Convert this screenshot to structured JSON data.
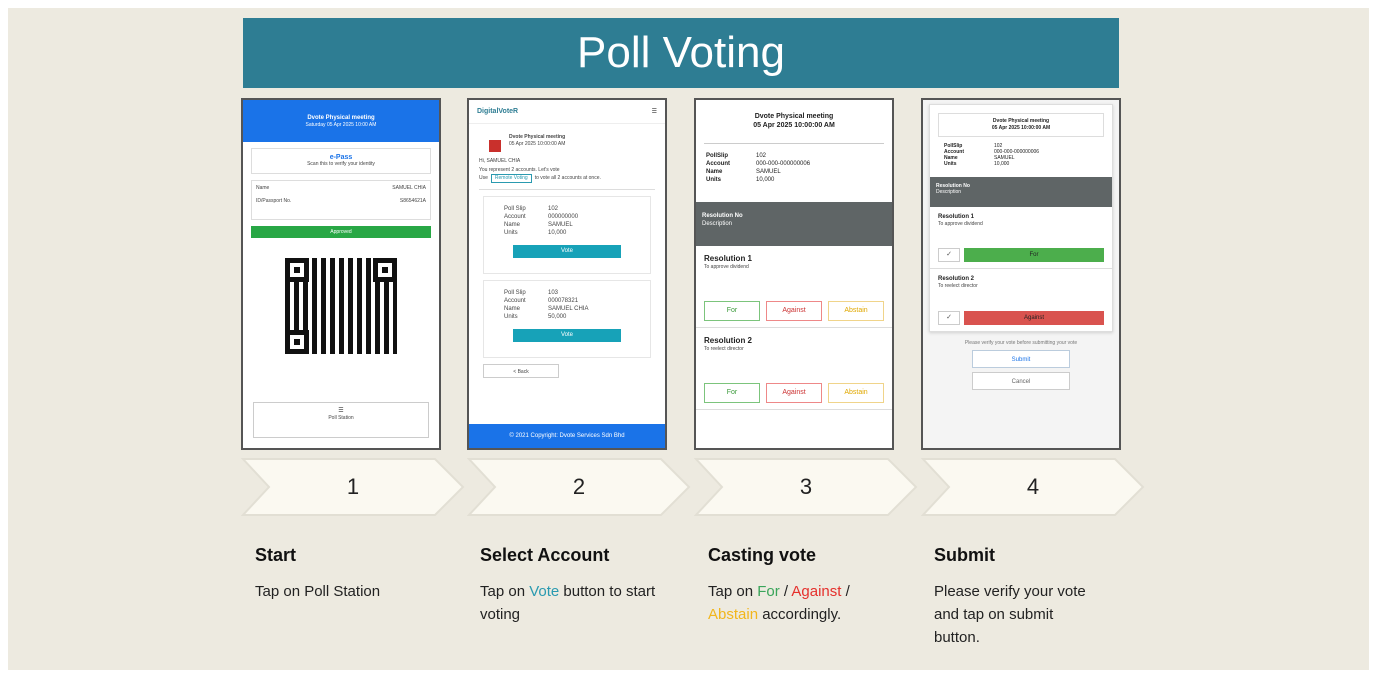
{
  "title": "Poll Voting",
  "steps": [
    {
      "number": "1",
      "heading": "Start",
      "text": "Tap on Poll Station"
    },
    {
      "number": "2",
      "heading": "Select Account",
      "text_pre": "Tap on ",
      "text_vote": "Vote",
      "text_post": " button to start voting"
    },
    {
      "number": "3",
      "heading": "Casting vote",
      "text_pre": "Tap on ",
      "text_for": "For",
      "sep1": " / ",
      "text_against": "Against",
      "sep2": " / ",
      "text_abstain": "Abstain",
      "text_post": " accordingly."
    },
    {
      "number": "4",
      "heading": "Submit",
      "text": "Please verify your vote and tap on submit button."
    }
  ],
  "phone1": {
    "header": "Dvote Physical meeting",
    "header_sub": "Saturday 05 Apr 2025 10:00 AM",
    "epass_title": "e-Pass",
    "epass_sub": "Scan this to verify your identity",
    "name_label": "Name",
    "name_value": "SAMUEL CHIA",
    "id_label": "ID/Passport No.",
    "id_value": "S8654621A",
    "bar": "Approved",
    "station_icon": "☰",
    "station": "Poll Station"
  },
  "phone2": {
    "brand": "DigitalVoteR",
    "menu_icon": "☰",
    "meet_title": "Dvote Physical meeting",
    "meet_date": "05 Apr 2025 10:00:00 AM",
    "greet": "Hi, SAMUEL CHIA",
    "represent": "You represent 2 accounts. Let's vote",
    "use": "Use",
    "remote_btn": "Remote Voting",
    "use_post": "to vote all 2 accounts at once.",
    "cards": [
      {
        "k1": "Poll Slip",
        "v1": "102",
        "k2": "Account",
        "v2": "000000000",
        "k3": "Name",
        "v3": "SAMUEL",
        "k4": "Units",
        "v4": "10,000"
      },
      {
        "k1": "Poll Slip",
        "v1": "103",
        "k2": "Account",
        "v2": "000078321",
        "k3": "Name",
        "v3": "SAMUEL CHIA",
        "k4": "Units",
        "v4": "50,000"
      }
    ],
    "vote_label": "Vote",
    "back": "< Back",
    "footer": "© 2021 Copyright: Dvote Services Sdn Bhd"
  },
  "phone3": {
    "meet_title": "Dvote Physical meeting",
    "meet_date": "05 Apr 2025 10:00:00 AM",
    "poll_slip_k": "PollSlip",
    "poll_slip_v": "102",
    "account_k": "Account",
    "account_v": "000-000-000000006",
    "name_k": "Name",
    "name_v": "SAMUEL",
    "units_k": "Units",
    "units_v": "10,000",
    "res_title": "Resolution No",
    "res_desc": "Description",
    "r1_title": "Resolution 1",
    "r1_desc": "To approve dividend",
    "r2_title": "Resolution 2",
    "r2_desc": "To reelect director",
    "for": "For",
    "against": "Against",
    "abstain": "Abstain"
  },
  "phone4": {
    "meet_title": "Dvote Physical meeting",
    "meet_date": "05 Apr 2025 10:00:00 AM",
    "poll_slip_k": "PollSlip",
    "poll_slip_v": "102",
    "account_k": "Account",
    "account_v": "000-000-000000006",
    "name_k": "Name",
    "name_v": "SAMUEL",
    "units_k": "Units",
    "units_v": "10,000",
    "res_title": "Resolution No",
    "res_desc": "Description",
    "r1_title": "Resolution 1",
    "r1_desc": "To approve dividend",
    "r2_title": "Resolution 2",
    "r2_desc": "To reelect director",
    "check": "✓",
    "r1_choice": "For",
    "r2_choice": "Against",
    "note": "Please verify your vote before submitting your vote",
    "submit": "Submit",
    "cancel": "Cancel"
  },
  "colors": {
    "banner": "#2e7d93",
    "for": "#3aa55a",
    "against": "#e5302c",
    "abstain": "#f2b61d",
    "vote": "#2a9ab0"
  }
}
